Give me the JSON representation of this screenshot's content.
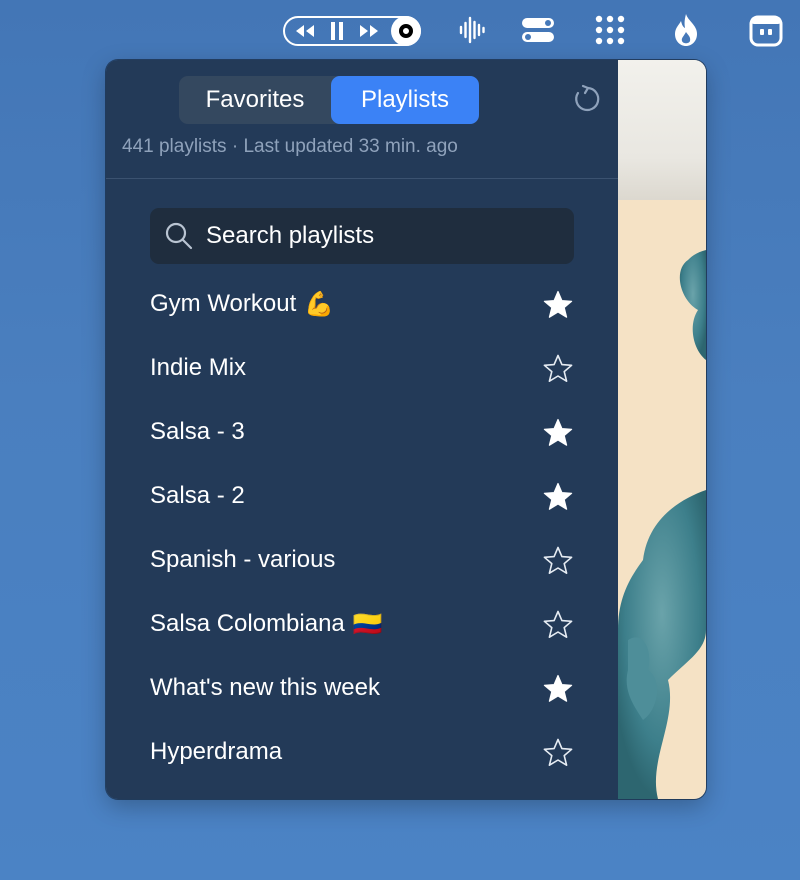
{
  "menubar": {
    "icons": [
      "rewind-icon",
      "pause-icon",
      "fast-forward-icon",
      "record-icon",
      "waveform-icon",
      "toggles-icon",
      "grid-dots-icon",
      "flame-icon",
      "robot-icon"
    ]
  },
  "popover": {
    "tabs": [
      {
        "label": "Favorites",
        "active": false
      },
      {
        "label": "Playlists",
        "active": true
      }
    ],
    "subtitle": "441 playlists · Last updated 33 min. ago",
    "search": {
      "placeholder": "Search playlists",
      "value": ""
    },
    "playlists": [
      {
        "name": "Gym Workout",
        "emoji": "💪",
        "starred": true
      },
      {
        "name": "Indie Mix",
        "emoji": "",
        "starred": false
      },
      {
        "name": "Salsa - 3",
        "emoji": "",
        "starred": true
      },
      {
        "name": "Salsa - 2",
        "emoji": "",
        "starred": true
      },
      {
        "name": "Spanish - various",
        "emoji": "",
        "starred": false
      },
      {
        "name": "Salsa Colombiana",
        "emoji": "🇨🇴",
        "starred": false
      },
      {
        "name": "What's new this week",
        "emoji": "",
        "starred": true
      },
      {
        "name": "Hyperdrama",
        "emoji": "",
        "starred": false
      }
    ]
  },
  "colors": {
    "panel": "#233a58",
    "accent": "#3b82f6",
    "desktop": "#4a7fbf"
  }
}
